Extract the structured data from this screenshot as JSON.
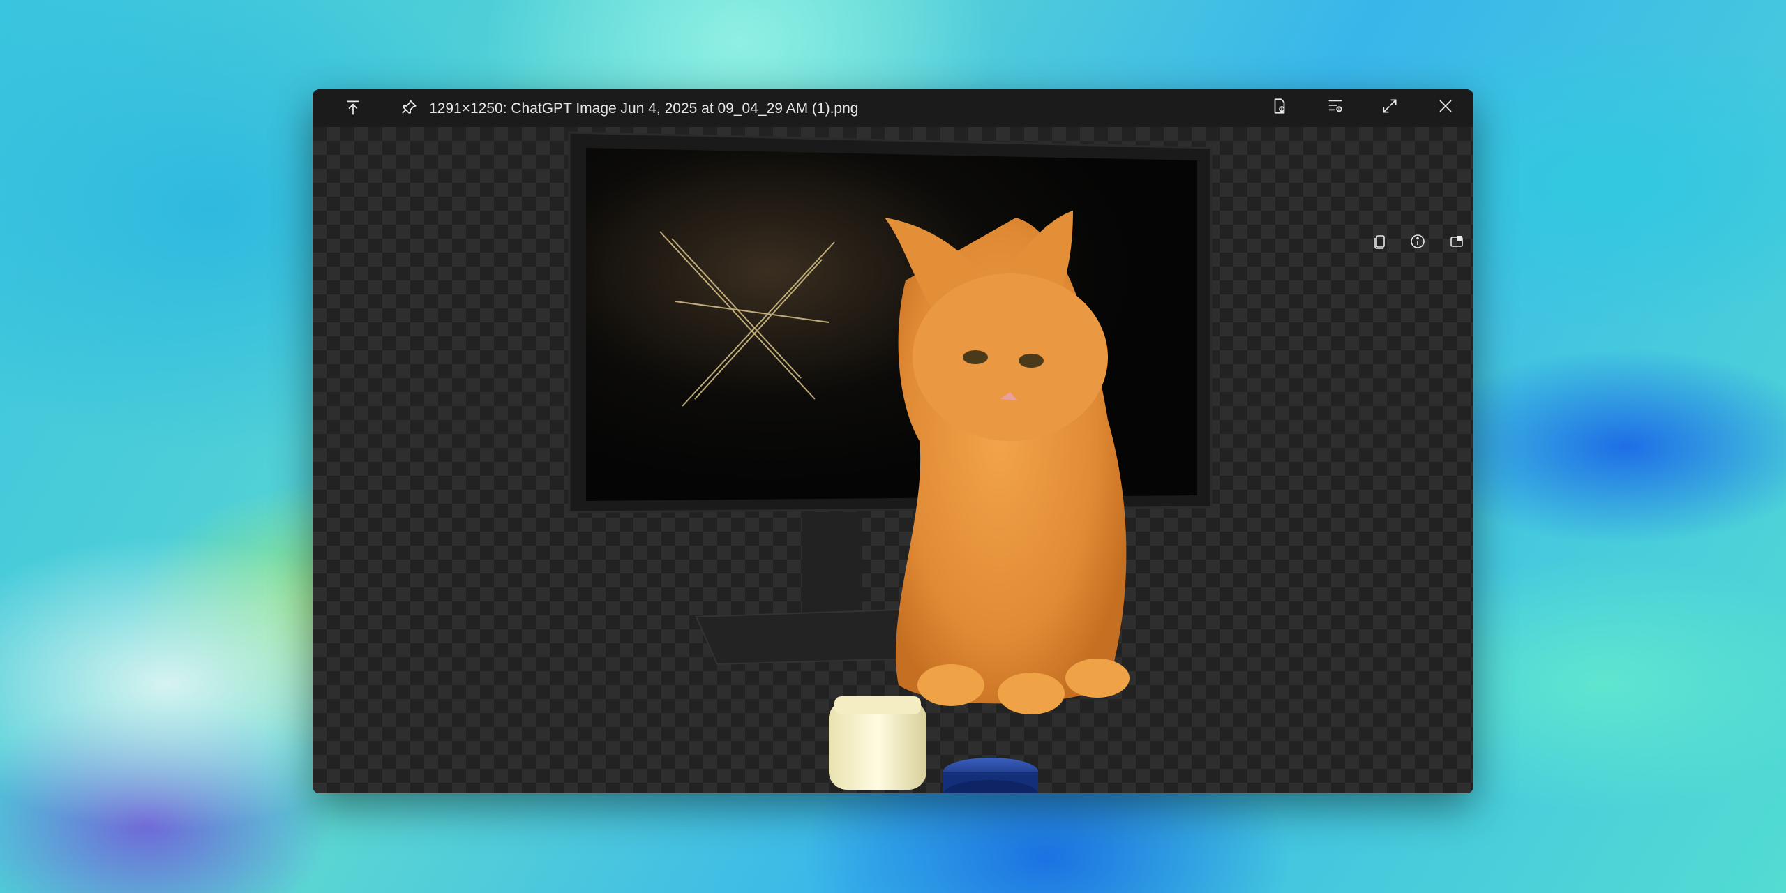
{
  "window": {
    "title": "1291×1250: ChatGPT Image Jun 4, 2025 at 09_04_29 AM (1).png"
  },
  "titlebar_buttons": {
    "left": [
      "move-to-top-icon",
      "pin-icon"
    ],
    "right": [
      "save-image-icon",
      "toggle-list-icon",
      "expand-icon",
      "close-icon"
    ]
  },
  "overlay_buttons": [
    "copy-icon",
    "info-icon",
    "picture-in-picture-icon"
  ],
  "colors": {
    "window_bg": "#161616",
    "titlebar_bg": "#1b1b1c",
    "checker_dark": "#222222",
    "checker_light": "#2e2e2e",
    "cat": "#e9953f",
    "jar_lid": "#1d3f8f"
  }
}
